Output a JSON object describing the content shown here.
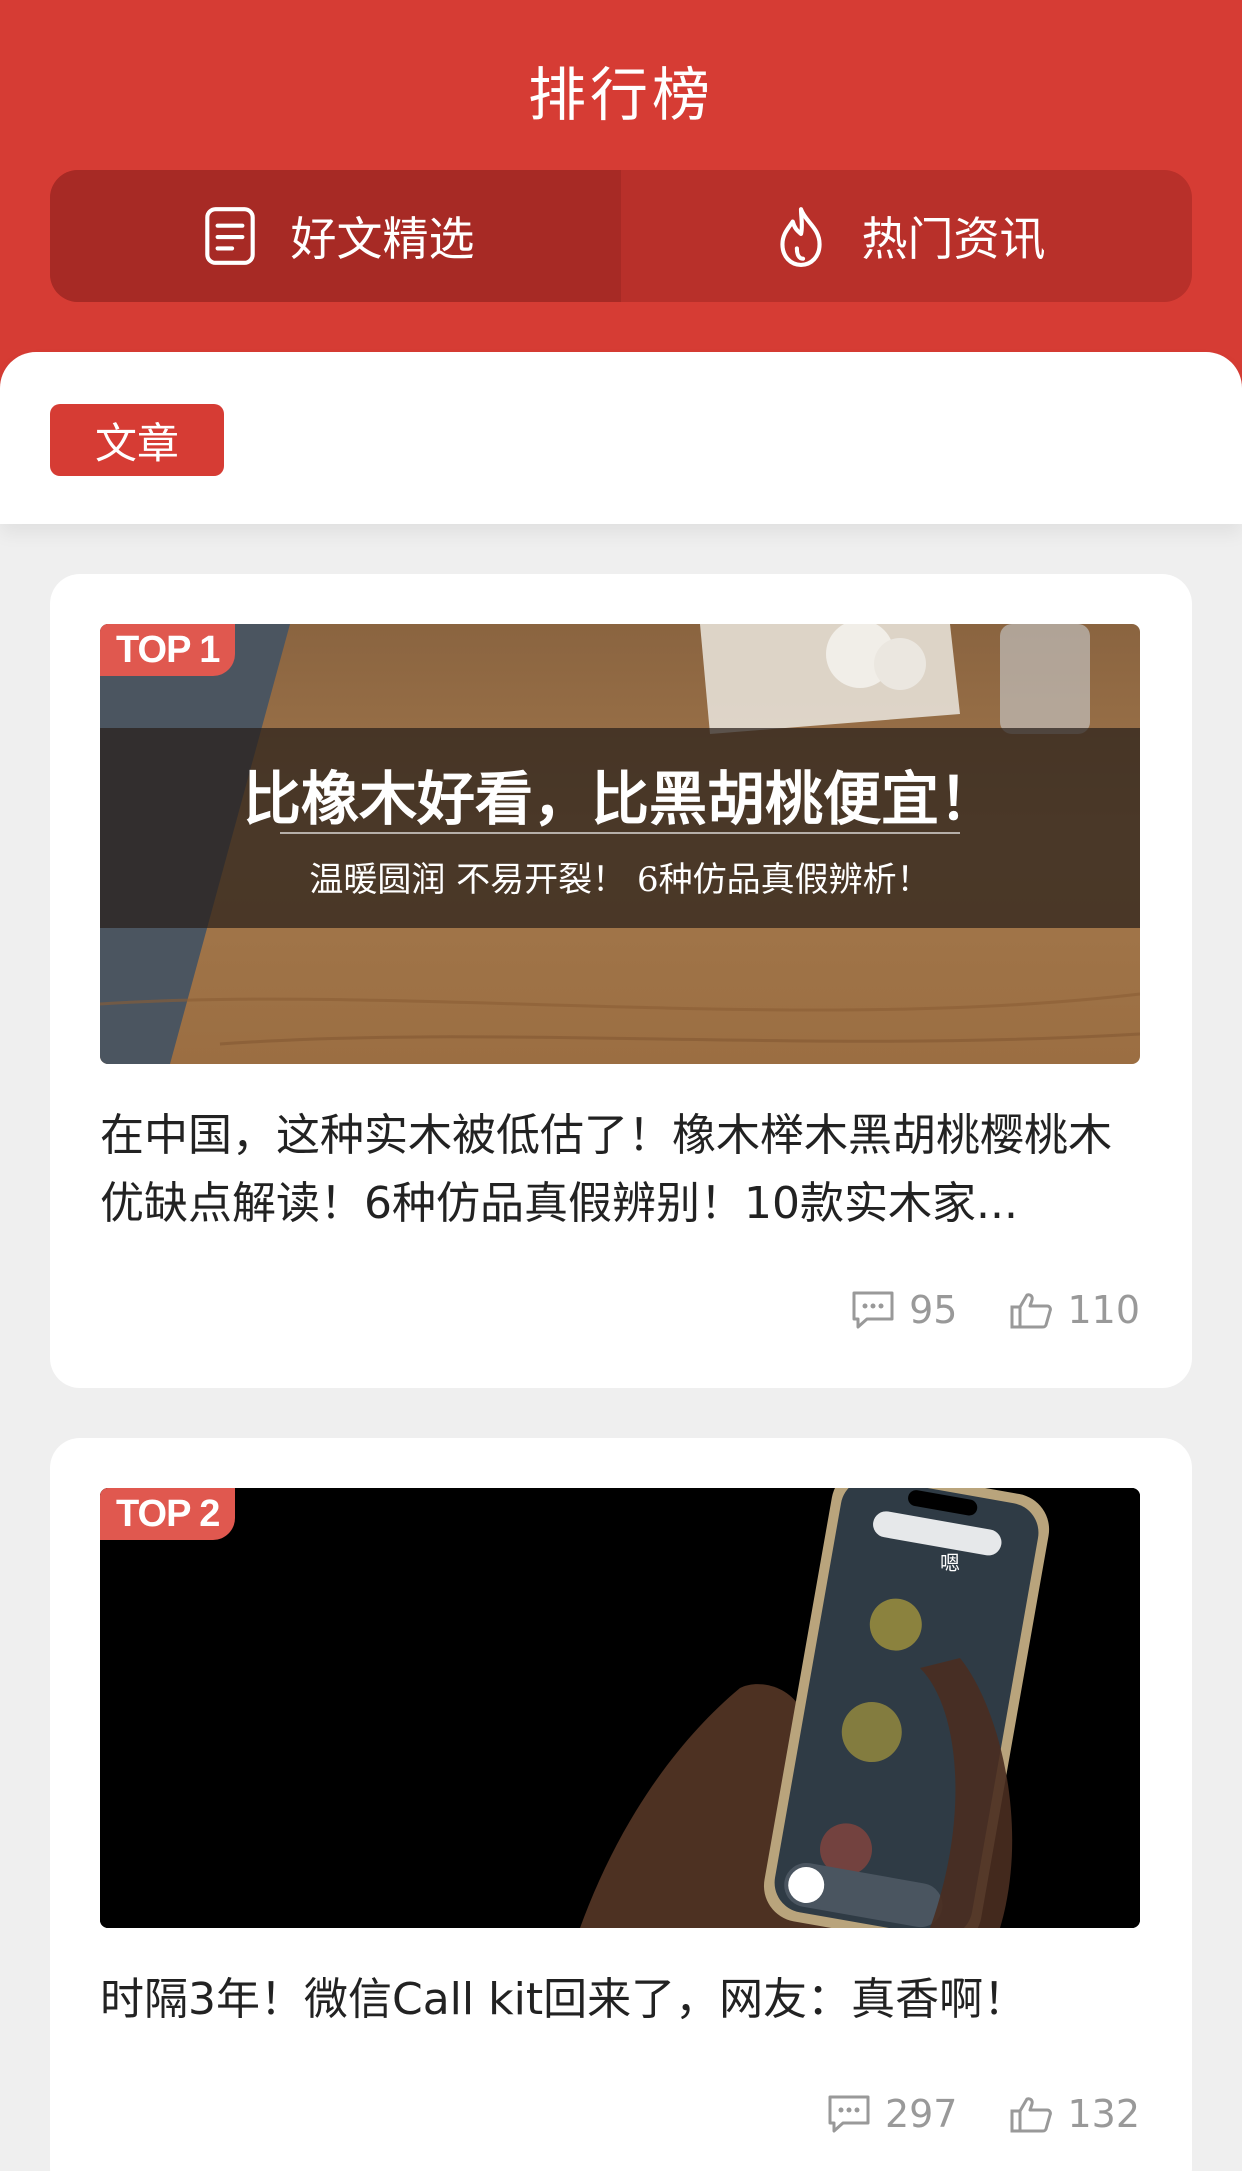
{
  "header": {
    "title": "排行榜",
    "tabs": [
      {
        "label": "好文精选",
        "icon": "document-icon",
        "active": true
      },
      {
        "label": "热门资讯",
        "icon": "flame-icon",
        "active": false
      }
    ]
  },
  "filter": {
    "chip_label": "文章"
  },
  "articles": [
    {
      "rank": "TOP 1",
      "image_title": "比橡木好看，比黑胡桃便宜！",
      "image_subtitle": "温暖圆润 不易开裂！ 6种仿品真假辨析！",
      "title": "在中国，这种实木被低估了！橡木榉木黑胡桃樱桃木优缺点解读！6种仿品真假辨别！10款实木家...",
      "comments": "95",
      "likes": "110"
    },
    {
      "rank": "TOP 2",
      "phone_label": "嗯",
      "title": "时隔3年！微信Call kit回来了，网友：真香啊！",
      "comments": "297",
      "likes": "132"
    }
  ],
  "colors": {
    "brand_red": "#d63c34",
    "tab_bg": "#b8302a",
    "tab_active": "#a72a25",
    "badge": "#e0584f",
    "stat_gray": "#999999"
  }
}
